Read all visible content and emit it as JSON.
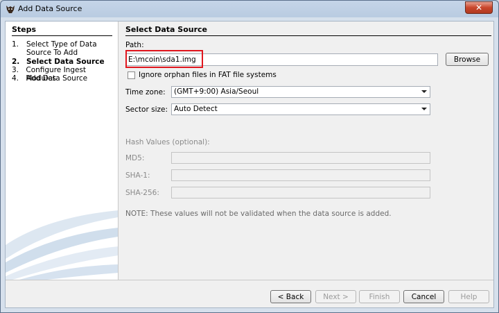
{
  "window": {
    "title": "Add Data Source",
    "close_glyph": "✕"
  },
  "steps": {
    "heading": "Steps",
    "items": [
      {
        "num": "1.",
        "label": "Select Type of Data Source To Add"
      },
      {
        "num": "2.",
        "label": "Select Data Source"
      },
      {
        "num": "3.",
        "label": "Configure Ingest Modules"
      },
      {
        "num": "4.",
        "label": "Add Data Source"
      }
    ],
    "active_index": 1
  },
  "main": {
    "heading": "Select Data Source",
    "path_label": "Path:",
    "path_value": "E:\\mcoin\\sda1.img",
    "browse_label": "Browse",
    "ignore_orphan_label": "Ignore orphan files in FAT file systems",
    "ignore_orphan_checked": false,
    "timezone_label": "Time zone:",
    "timezone_value": "(GMT+9:00) Asia/Seoul",
    "sector_label": "Sector size:",
    "sector_value": "Auto Detect",
    "hash_heading": "Hash Values (optional):",
    "md5_label": "MD5:",
    "sha1_label": "SHA-1:",
    "sha256_label": "SHA-256:",
    "note": "NOTE: These values will not be validated when the data source is added."
  },
  "footer": {
    "back": "< Back",
    "next": "Next >",
    "finish": "Finish",
    "cancel": "Cancel",
    "help": "Help"
  },
  "colors": {
    "highlight": "#e0161e",
    "window_frame": "#b9cbe1"
  }
}
